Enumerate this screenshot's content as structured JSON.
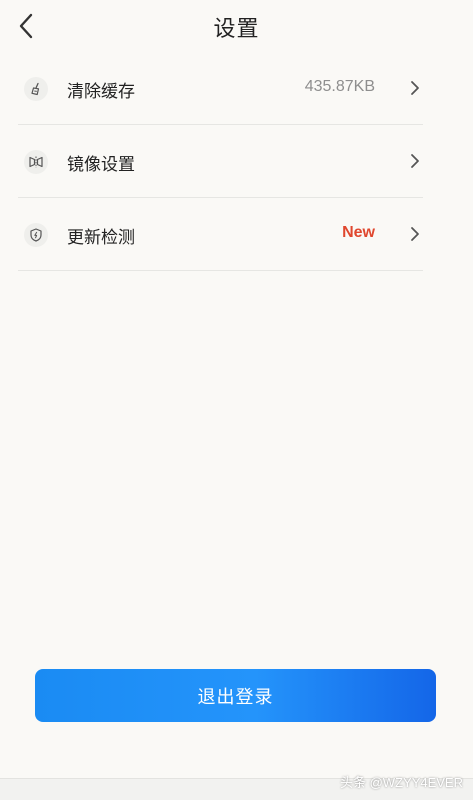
{
  "header": {
    "title": "设置"
  },
  "settings": {
    "items": [
      {
        "label": "清除缓存",
        "value": "435.87KB",
        "icon": "broom-icon"
      },
      {
        "label": "镜像设置",
        "value": "",
        "icon": "mirror-icon"
      },
      {
        "label": "更新检测",
        "value": "New",
        "icon": "shield-icon",
        "value_color": "#e0472e"
      }
    ]
  },
  "logout": {
    "label": "退出登录",
    "color": "#1a8bf3"
  },
  "watermark": {
    "text": "头条 @WZYY4EVER"
  }
}
